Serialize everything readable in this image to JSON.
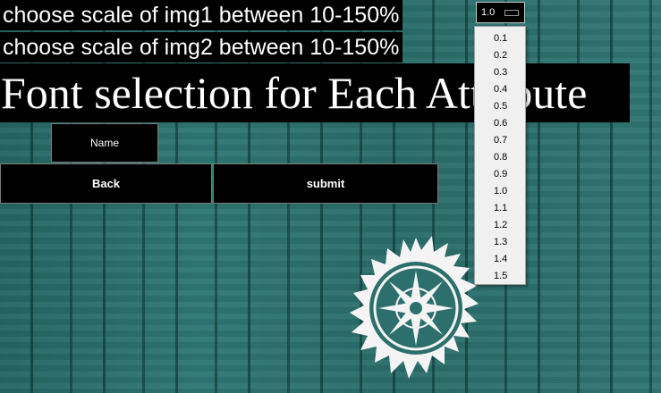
{
  "labels": {
    "img1_scale": "choose scale of img1 between 10-150%",
    "img2_scale": "choose scale of img2 between 10-150%",
    "title": "Font selection for Each Attribute"
  },
  "buttons": {
    "name": "Name",
    "back": "Back",
    "submit": "submit"
  },
  "scale_select": {
    "value": "1.0",
    "options": [
      "0.1",
      "0.2",
      "0.3",
      "0.4",
      "0.5",
      "0.6",
      "0.7",
      "0.8",
      "0.9",
      "1.0",
      "1.1",
      "1.2",
      "1.3",
      "1.4",
      "1.5"
    ]
  },
  "colors": {
    "background": "#2c6f6c",
    "panel": "#000000",
    "text": "#ffffff",
    "dropdown_bg": "#f0f0f0"
  },
  "icons": {
    "emblem": "snowflake-star-emblem"
  }
}
